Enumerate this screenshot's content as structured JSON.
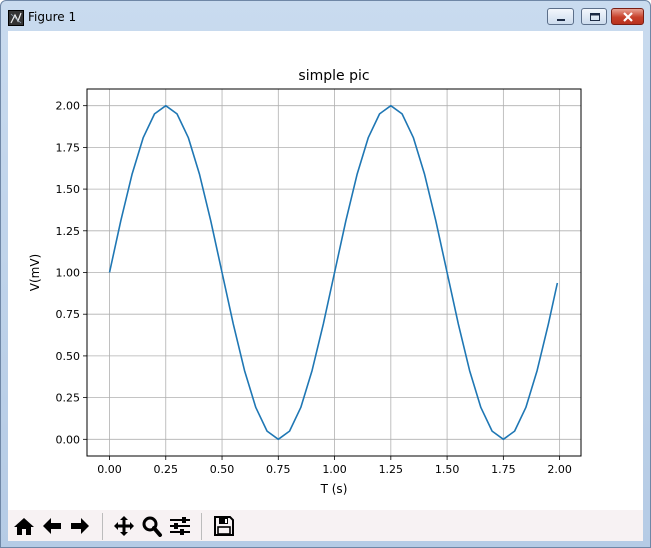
{
  "window": {
    "title": "Figure 1",
    "icon": "matplotlib-figure-icon",
    "controls": [
      "minimize",
      "maximize",
      "close"
    ]
  },
  "chart_data": {
    "type": "line",
    "title": "simple pic",
    "xlabel": "T (s)",
    "ylabel": "V(mV)",
    "xlim": [
      -0.1,
      2.095
    ],
    "ylim": [
      -0.1,
      2.1
    ],
    "xticks": [
      0.0,
      0.25,
      0.5,
      0.75,
      1.0,
      1.25,
      1.5,
      1.75,
      2.0
    ],
    "xtick_labels": [
      "0.00",
      "0.25",
      "0.50",
      "0.75",
      "1.00",
      "1.25",
      "1.50",
      "1.75",
      "2.00"
    ],
    "yticks": [
      0.0,
      0.25,
      0.5,
      0.75,
      1.0,
      1.25,
      1.5,
      1.75,
      2.0
    ],
    "ytick_labels": [
      "0.00",
      "0.25",
      "0.50",
      "0.75",
      "1.00",
      "1.25",
      "1.50",
      "1.75",
      "2.00"
    ],
    "grid": true,
    "line_color": "#1f77b4",
    "series": [
      {
        "x": [
          0.0,
          0.05,
          0.1,
          0.15,
          0.2,
          0.25,
          0.3,
          0.35,
          0.4,
          0.45,
          0.5,
          0.55,
          0.6,
          0.65,
          0.7,
          0.75,
          0.8,
          0.85,
          0.9,
          0.95,
          1.0,
          1.05,
          1.1,
          1.15,
          1.2,
          1.25,
          1.3,
          1.35,
          1.4,
          1.45,
          1.5,
          1.55,
          1.6,
          1.65,
          1.7,
          1.75,
          1.8,
          1.85,
          1.9,
          1.95,
          1.99
        ],
        "values": [
          1.0,
          1.309,
          1.588,
          1.809,
          1.951,
          2.0,
          1.951,
          1.809,
          1.588,
          1.309,
          1.0,
          0.691,
          0.412,
          0.191,
          0.049,
          0.0,
          0.049,
          0.191,
          0.412,
          0.691,
          1.0,
          1.309,
          1.588,
          1.809,
          1.951,
          2.0,
          1.951,
          1.809,
          1.588,
          1.309,
          1.0,
          0.691,
          0.412,
          0.191,
          0.049,
          0.0,
          0.049,
          0.191,
          0.412,
          0.691,
          0.937
        ]
      }
    ]
  },
  "toolbar": {
    "buttons": [
      {
        "name": "home-button",
        "icon": "home-icon"
      },
      {
        "name": "back-button",
        "icon": "arrow-left-icon"
      },
      {
        "name": "forward-button",
        "icon": "arrow-right-icon"
      },
      {
        "name": "pan-button",
        "icon": "move-icon"
      },
      {
        "name": "zoom-button",
        "icon": "magnifier-icon"
      },
      {
        "name": "configure-subplots-button",
        "icon": "sliders-icon"
      },
      {
        "name": "save-button",
        "icon": "floppy-disk-icon"
      }
    ]
  }
}
